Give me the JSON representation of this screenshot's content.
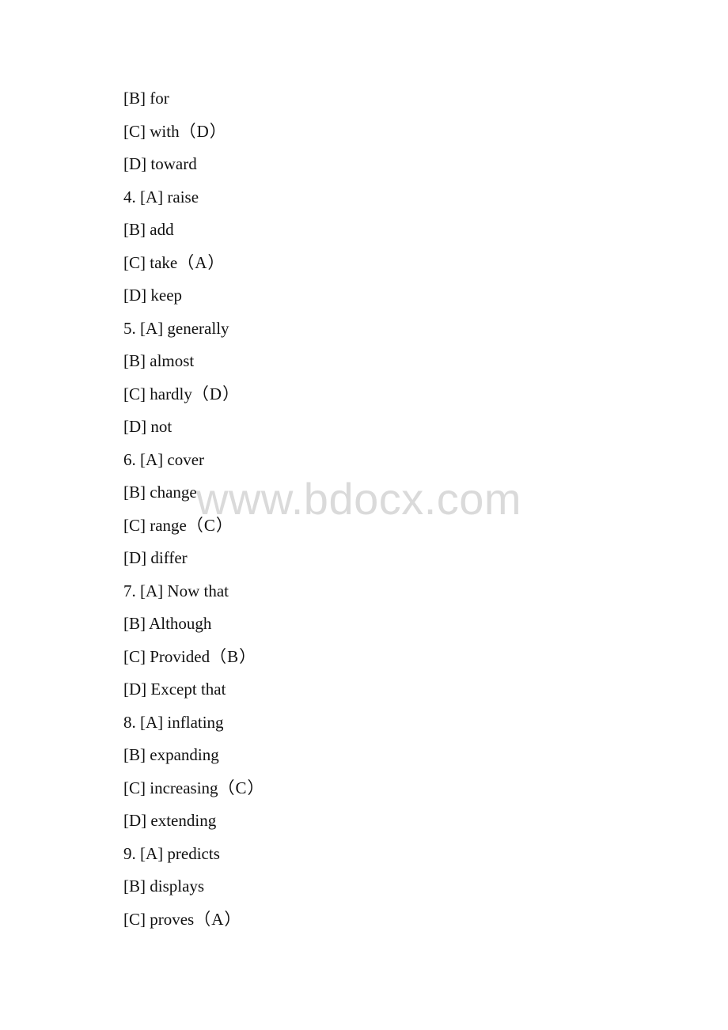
{
  "watermark": "www.bdocx.com",
  "lines": [
    {
      "text": "[B] for",
      "answer": ""
    },
    {
      "text": "[C] with",
      "answer": "（D）"
    },
    {
      "text": "[D] toward",
      "answer": ""
    },
    {
      "text": "4. [A] raise",
      "answer": ""
    },
    {
      "text": "[B] add",
      "answer": ""
    },
    {
      "text": "[C] take",
      "answer": "（A）"
    },
    {
      "text": "[D] keep",
      "answer": ""
    },
    {
      "text": "5. [A] generally",
      "answer": ""
    },
    {
      "text": "[B] almost",
      "answer": ""
    },
    {
      "text": "[C] hardly",
      "answer": "（D）"
    },
    {
      "text": "[D] not",
      "answer": ""
    },
    {
      "text": "6. [A] cover",
      "answer": ""
    },
    {
      "text": "[B] change",
      "answer": ""
    },
    {
      "text": "[C] range",
      "answer": "（C）"
    },
    {
      "text": "[D] differ",
      "answer": ""
    },
    {
      "text": "7. [A] Now that",
      "answer": ""
    },
    {
      "text": "[B] Although",
      "answer": ""
    },
    {
      "text": "[C] Provided",
      "answer": "（B）"
    },
    {
      "text": "[D] Except that",
      "answer": ""
    },
    {
      "text": "8. [A] inflating",
      "answer": ""
    },
    {
      "text": "[B] expanding",
      "answer": ""
    },
    {
      "text": "[C] increasing",
      "answer": "（C）"
    },
    {
      "text": "[D] extending",
      "answer": ""
    },
    {
      "text": "9. [A] predicts",
      "answer": ""
    },
    {
      "text": "[B] displays",
      "answer": ""
    },
    {
      "text": "[C] proves",
      "answer": "（A）"
    }
  ]
}
